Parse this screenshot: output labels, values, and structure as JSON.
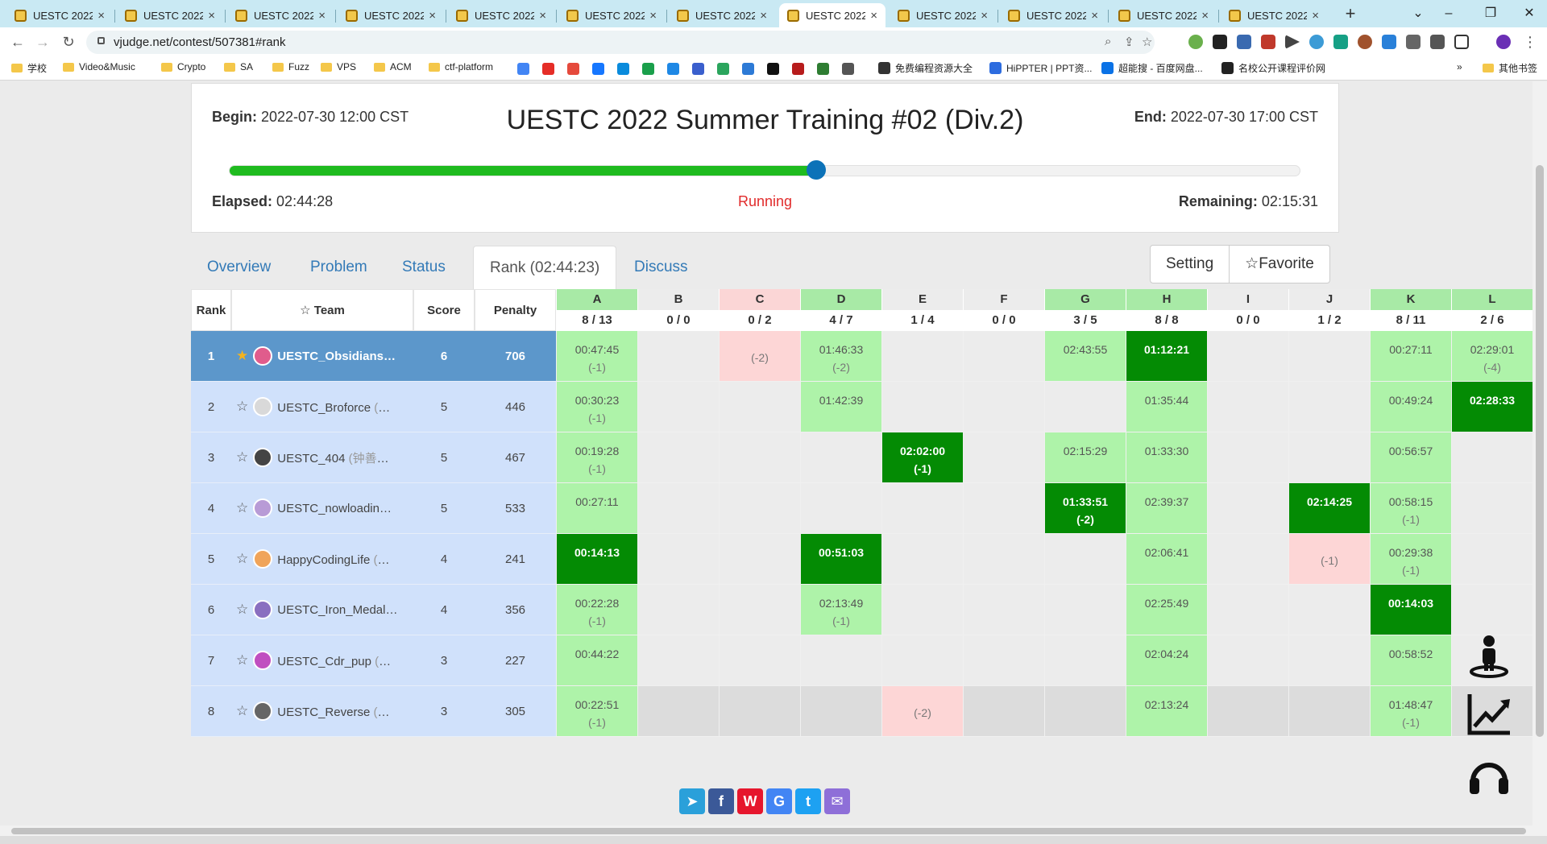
{
  "browser": {
    "tabs": [
      {
        "label": "UESTC 2022"
      },
      {
        "label": "UESTC 2022"
      },
      {
        "label": "UESTC 2022"
      },
      {
        "label": "UESTC 2022"
      },
      {
        "label": "UESTC 2022"
      },
      {
        "label": "UESTC 2022"
      },
      {
        "label": "UESTC 2022"
      },
      {
        "label": "UESTC 2022",
        "active": true
      },
      {
        "label": "UESTC 2022"
      },
      {
        "label": "UESTC 2022"
      },
      {
        "label": "UESTC 2022"
      },
      {
        "label": "UESTC 2022"
      }
    ],
    "url": "vjudge.net/contest/507381#rank",
    "bookmarks": [
      "学校",
      "Video&Music",
      "Crypto",
      "SA",
      "Fuzz",
      "VPS",
      "ACM",
      "ctf-platform",
      "免费编程资源大全",
      "HiPPTER | PPT资...",
      "超能搜 - 百度网盘...",
      "名校公开课程评价网",
      "其他书签"
    ]
  },
  "contest": {
    "begin_label": "Begin:",
    "begin": "2022-07-30 12:00 CST",
    "title": "UESTC 2022 Summer Training #02 (Div.2)",
    "end_label": "End:",
    "end": "2022-07-30 17:00 CST",
    "progress_fraction": 0.5481,
    "elapsed_label": "Elapsed:",
    "elapsed": "02:44:28",
    "status": "Running",
    "remaining_label": "Remaining:",
    "remaining": "02:15:31"
  },
  "nav": {
    "tabs": [
      "Overview",
      "Problem",
      "Status",
      "Rank (02:44:23)",
      "Discuss"
    ],
    "setting": "Setting",
    "favorite": "☆Favorite"
  },
  "table": {
    "headers": {
      "rank": "Rank",
      "team": "☆ Team",
      "score": "Score",
      "penalty": "Penalty"
    },
    "problems": [
      {
        "letter": "A",
        "count": "8 / 13",
        "color": "#a8eaa6"
      },
      {
        "letter": "B",
        "count": "0 / 0",
        "color": "#ececec"
      },
      {
        "letter": "C",
        "count": "0 / 2",
        "color": "#fbd6d6"
      },
      {
        "letter": "D",
        "count": "4 / 7",
        "color": "#a8eaa6"
      },
      {
        "letter": "E",
        "count": "1 / 4",
        "color": "#ececec"
      },
      {
        "letter": "F",
        "count": "0 / 0",
        "color": "#ececec"
      },
      {
        "letter": "G",
        "count": "3 / 5",
        "color": "#a8eaa6"
      },
      {
        "letter": "H",
        "count": "8 / 8",
        "color": "#a8eaa6"
      },
      {
        "letter": "I",
        "count": "0 / 0",
        "color": "#ececec"
      },
      {
        "letter": "J",
        "count": "1 / 2",
        "color": "#ececec"
      },
      {
        "letter": "K",
        "count": "8 / 11",
        "color": "#a8eaa6"
      },
      {
        "letter": "L",
        "count": "2 / 6",
        "color": "#a8eaa6"
      }
    ],
    "rows": [
      {
        "rank": "1",
        "team": "UESTC_Obsidians",
        "members": " (...",
        "score": "6",
        "penalty": "706",
        "starred": true,
        "cells": [
          [
            "ac",
            "00:47:45",
            "(-1)"
          ],
          null,
          [
            "wa",
            "",
            "(-2)"
          ],
          [
            "ac",
            "01:46:33",
            "(-2)"
          ],
          null,
          null,
          [
            "ac",
            "02:43:55",
            ""
          ],
          [
            "fb",
            "01:12:21",
            ""
          ],
          null,
          null,
          [
            "ac",
            "00:27:11",
            ""
          ],
          [
            "ac",
            "02:29:01",
            "(-4)"
          ]
        ]
      },
      {
        "rank": "2",
        "team": "UESTC_Broforce",
        "members": " (李林...",
        "score": "5",
        "penalty": "446",
        "cells": [
          [
            "ac",
            "00:30:23",
            "(-1)"
          ],
          null,
          null,
          [
            "ac",
            "01:42:39",
            ""
          ],
          null,
          null,
          null,
          [
            "ac",
            "01:35:44",
            ""
          ],
          null,
          null,
          [
            "ac",
            "00:49:24",
            ""
          ],
          [
            "fb",
            "02:28:33",
            ""
          ]
        ]
      },
      {
        "rank": "3",
        "team": "UESTC_404",
        "members": " (钟善晖 张...",
        "score": "5",
        "penalty": "467",
        "cells": [
          [
            "ac",
            "00:19:28",
            "(-1)"
          ],
          null,
          null,
          null,
          [
            "fb",
            "02:02:00",
            "(-1)"
          ],
          null,
          [
            "ac",
            "02:15:29",
            ""
          ],
          [
            "ac",
            "01:33:30",
            ""
          ],
          null,
          null,
          [
            "ac",
            "00:56:57",
            ""
          ],
          null
        ]
      },
      {
        "rank": "4",
        "team": "UESTC_nowloading",
        "members": " (...",
        "score": "5",
        "penalty": "533",
        "cells": [
          [
            "ac",
            "00:27:11",
            ""
          ],
          null,
          null,
          null,
          null,
          null,
          [
            "fb",
            "01:33:51",
            "(-2)"
          ],
          [
            "ac",
            "02:39:37",
            ""
          ],
          null,
          [
            "fb",
            "02:14:25",
            ""
          ],
          [
            "ac",
            "00:58:15",
            "(-1)"
          ],
          null
        ]
      },
      {
        "rank": "5",
        "team": "HappyCodingLife",
        "members": " (朱...",
        "score": "4",
        "penalty": "241",
        "cells": [
          [
            "fb",
            "00:14:13",
            ""
          ],
          null,
          null,
          [
            "fb",
            "00:51:03",
            ""
          ],
          null,
          null,
          null,
          [
            "ac",
            "02:06:41",
            ""
          ],
          null,
          [
            "wa",
            "",
            "(-1)"
          ],
          [
            "ac",
            "00:29:38",
            "(-1)"
          ],
          null
        ]
      },
      {
        "rank": "6",
        "team": "UESTC_Iron_Medal",
        "members": " (...",
        "score": "4",
        "penalty": "356",
        "cells": [
          [
            "ac",
            "00:22:28",
            "(-1)"
          ],
          null,
          null,
          [
            "ac",
            "02:13:49",
            "(-1)"
          ],
          null,
          null,
          null,
          [
            "ac",
            "02:25:49",
            ""
          ],
          null,
          null,
          [
            "fb",
            "00:14:03",
            ""
          ],
          null
        ]
      },
      {
        "rank": "7",
        "team": "UESTC_Cdr_pup",
        "members": " (常铭...",
        "score": "3",
        "penalty": "227",
        "cells": [
          [
            "ac",
            "00:44:22",
            ""
          ],
          null,
          null,
          null,
          null,
          null,
          null,
          [
            "ac",
            "02:04:24",
            ""
          ],
          null,
          null,
          [
            "ac",
            "00:58:52",
            ""
          ],
          null
        ]
      },
      {
        "rank": "8",
        "team": "UESTC_Reverse",
        "members": " (魏祥...",
        "score": "3",
        "penalty": "305",
        "cells": [
          [
            "ac",
            "00:22:51",
            "(-1)"
          ],
          null,
          null,
          null,
          [
            "wa",
            "",
            "(-2)"
          ],
          null,
          null,
          [
            "ac",
            "02:13:24",
            ""
          ],
          null,
          null,
          [
            "ac",
            "01:48:47",
            "(-1)"
          ],
          null
        ]
      }
    ]
  },
  "float_icons": [
    "user-map-icon",
    "trend-chart-icon",
    "headset-icon"
  ],
  "share": [
    {
      "name": "telegram-icon",
      "color": "#2aa0da",
      "glyph": "➤"
    },
    {
      "name": "facebook-icon",
      "color": "#3b5998",
      "glyph": "f"
    },
    {
      "name": "weibo-icon",
      "color": "#e6162d",
      "glyph": "W"
    },
    {
      "name": "google-icon",
      "color": "#4285f4",
      "glyph": "G"
    },
    {
      "name": "twitter-icon",
      "color": "#1da1f2",
      "glyph": "t"
    },
    {
      "name": "email-icon",
      "color": "#8e6fd8",
      "glyph": "✉"
    }
  ]
}
